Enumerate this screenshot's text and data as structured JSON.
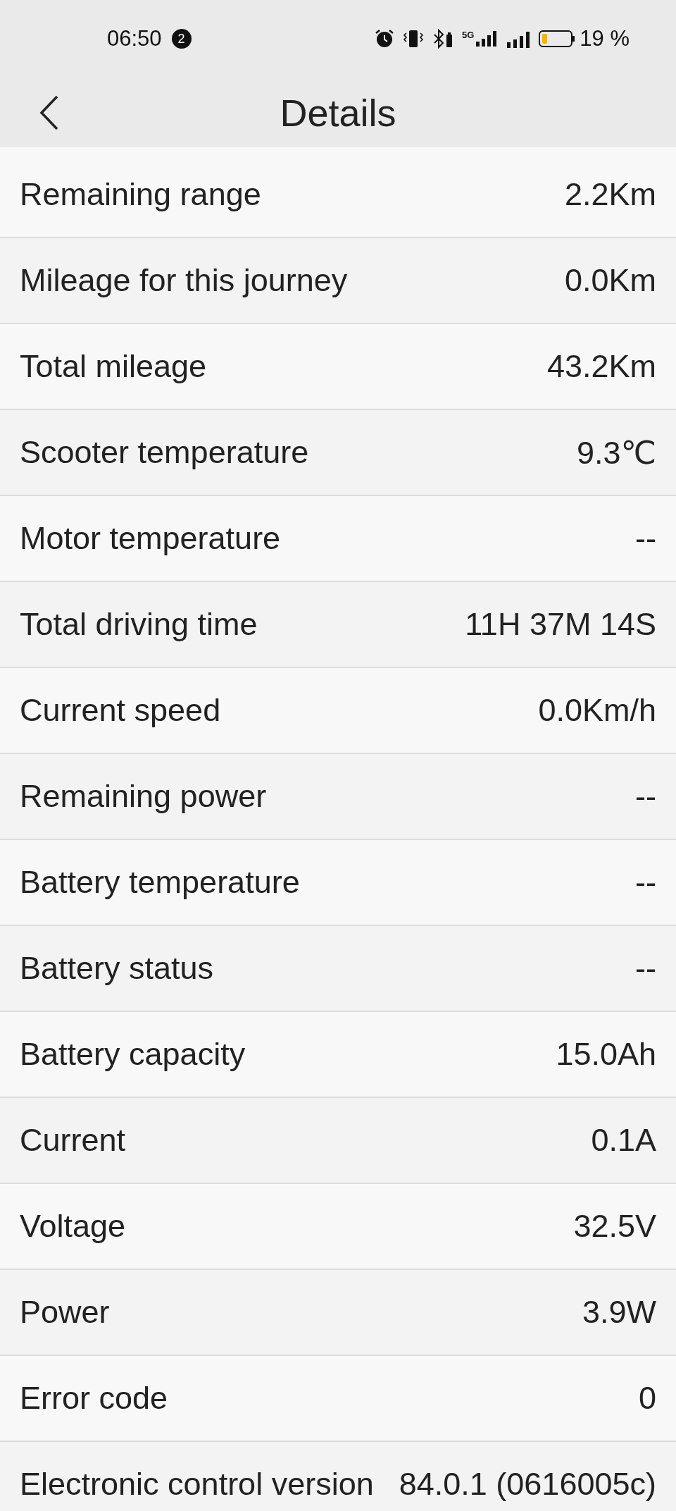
{
  "status_bar": {
    "time": "06:50",
    "notification_count": "2",
    "network_type": "5G",
    "battery_percent": "19 %"
  },
  "header": {
    "title": "Details"
  },
  "rows": [
    {
      "label": "Remaining range",
      "value": "2.2Km"
    },
    {
      "label": "Mileage for this journey",
      "value": "0.0Km"
    },
    {
      "label": "Total mileage",
      "value": "43.2Km"
    },
    {
      "label": "Scooter temperature",
      "value": "9.3℃"
    },
    {
      "label": "Motor temperature",
      "value": "--"
    },
    {
      "label": "Total driving time",
      "value": "11H 37M 14S"
    },
    {
      "label": "Current speed",
      "value": "0.0Km/h"
    },
    {
      "label": "Remaining power",
      "value": "--"
    },
    {
      "label": "Battery temperature",
      "value": "--"
    },
    {
      "label": "Battery status",
      "value": "--"
    },
    {
      "label": "Battery capacity",
      "value": "15.0Ah"
    },
    {
      "label": "Current",
      "value": "0.1A"
    },
    {
      "label": "Voltage",
      "value": "32.5V"
    },
    {
      "label": "Power",
      "value": "3.9W"
    },
    {
      "label": "Error code",
      "value": "0"
    },
    {
      "label": "Electronic control version",
      "value": "84.0.1 (0616005c)"
    }
  ]
}
